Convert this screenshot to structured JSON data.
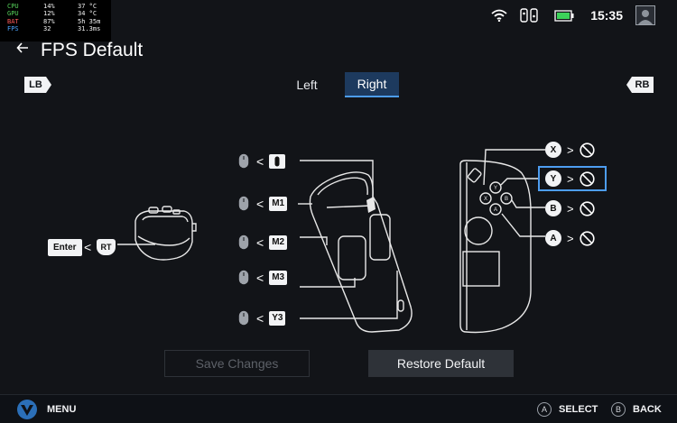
{
  "perf": {
    "rows": [
      {
        "label": "CPU",
        "v1": "14%",
        "v2": "37 °C",
        "color": "#56d35b"
      },
      {
        "label": "GPU",
        "v1": "12%",
        "v2": "34 °C",
        "color": "#56d35b"
      },
      {
        "label": "BAT",
        "v1": "87%",
        "v2": "5h 35m",
        "color": "#ff5a5a"
      },
      {
        "label": "FPS",
        "v1": "32",
        "v2": "31.3ms",
        "color": "#4da6ff"
      }
    ]
  },
  "status": {
    "time": "15:35",
    "battery_color": "#3cd25a",
    "icons": [
      "wifi-icon",
      "controllers-icon",
      "battery-icon",
      "user-avatar"
    ]
  },
  "header": {
    "back_icon": "arrow-left-icon",
    "title": "FPS Default"
  },
  "shoulders": {
    "lb": "LB",
    "rb": "RB"
  },
  "tabs": [
    {
      "label": "Left",
      "selected": false
    },
    {
      "label": "Right",
      "selected": true
    }
  ],
  "trigger_map": {
    "key": "Enter",
    "button": "RT"
  },
  "stick_mappings": [
    {
      "key": "wheel",
      "icon": "scroll-wheel-icon"
    },
    {
      "key": "M1"
    },
    {
      "key": "M2"
    },
    {
      "key": "M3"
    },
    {
      "key": "Y3"
    }
  ],
  "face_mappings": [
    {
      "button": "X",
      "target": "none",
      "selected": false
    },
    {
      "button": "Y",
      "target": "none",
      "selected": true
    },
    {
      "button": "B",
      "target": "none",
      "selected": false
    },
    {
      "button": "A",
      "target": "none",
      "selected": false
    }
  ],
  "actions": {
    "save": "Save Changes",
    "restore": "Restore Default"
  },
  "bottombar": {
    "menu": "MENU",
    "hints": [
      {
        "button": "A",
        "label": "SELECT"
      },
      {
        "button": "B",
        "label": "BACK"
      }
    ]
  },
  "colors": {
    "accent": "#4d9df0",
    "background": "#121418"
  }
}
